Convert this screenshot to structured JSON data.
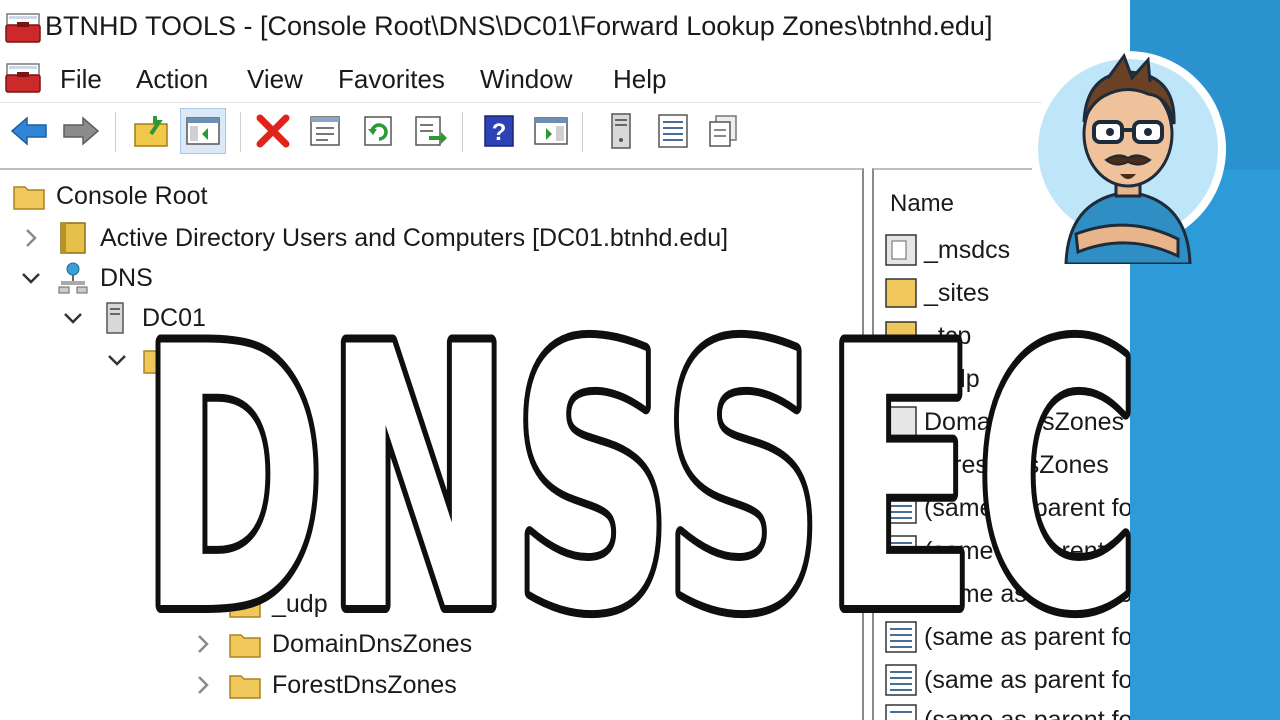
{
  "window": {
    "title": "BTNHD TOOLS - [Console Root\\DNS\\DC01\\Forward Lookup Zones\\btnhd.edu]"
  },
  "menu": {
    "items": [
      "File",
      "Action",
      "View",
      "Favorites",
      "Window",
      "Help"
    ]
  },
  "toolbar": {
    "buttons": [
      "back-icon",
      "forward-icon",
      "up-folder-icon",
      "show-hide-tree-icon",
      "delete-icon",
      "properties-icon",
      "refresh-icon",
      "export-list-icon",
      "help-icon",
      "action-pane-icon",
      "server-icon",
      "list-icon",
      "copy-icon"
    ]
  },
  "tree": {
    "console_root": "Console Root",
    "active_directory": "Active Directory Users and Computers [DC01.btnhd.edu]",
    "dns": "DNS",
    "dc01": "DC01",
    "udp": "_udp",
    "domain_dns_zones": "DomainDnsZones",
    "forest_dns_zones": "ForestDnsZones"
  },
  "list": {
    "header_name": "Name",
    "rows": [
      "_msdcs",
      "_sites",
      "_tcp",
      "_udp",
      "DomainDnsZones",
      "ForestDnsZones",
      "(same as parent folder)",
      "(same as parent folder)",
      "(same as parent folder)",
      "(same as parent folder)",
      "(same as parent folder)",
      "(same as parent folder)"
    ]
  },
  "overlay": {
    "headline": "DNSSEC"
  },
  "colors": {
    "accent_blue": "#2d9bd8",
    "folder": "#e9c46a",
    "delete_red": "#e0241b"
  }
}
